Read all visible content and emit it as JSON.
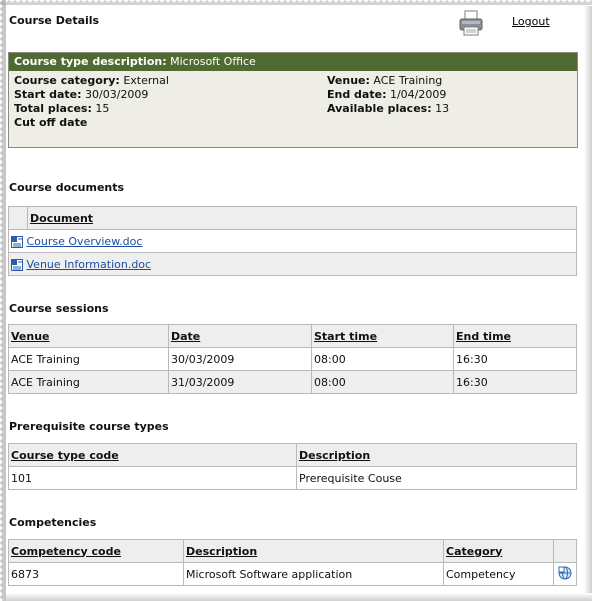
{
  "header": {
    "title": "Course Details",
    "logout_label": "Logout"
  },
  "summary": {
    "type_label": "Course type description:",
    "type_value": "Microsoft Office",
    "category_label": "Course category:",
    "category_value": "External",
    "start_label": "Start date:",
    "start_value": "30/03/2009",
    "total_label": "Total places:",
    "total_value": "15",
    "cutoff_label": "Cut off date",
    "venue_label": "Venue:",
    "venue_value": "ACE Training",
    "end_label": "End date:",
    "end_value": "1/04/2009",
    "available_label": "Available places:",
    "available_value": "13"
  },
  "documents": {
    "title": "Course documents",
    "header": "Document",
    "items": [
      "Course Overview.doc",
      "Venue Information.doc"
    ]
  },
  "sessions": {
    "title": "Course sessions",
    "headers": [
      "Venue",
      "Date",
      "Start time",
      "End time"
    ],
    "rows": [
      [
        "ACE Training",
        "30/03/2009",
        "08:00",
        "16:30"
      ],
      [
        "ACE Training",
        "31/03/2009",
        "08:00",
        "16:30"
      ]
    ]
  },
  "prerequisites": {
    "title": "Prerequisite course types",
    "headers": [
      "Course type code",
      "Description"
    ],
    "rows": [
      [
        "101",
        "Prerequisite Couse"
      ]
    ]
  },
  "competencies": {
    "title": "Competencies",
    "headers": [
      "Competency code",
      "Description",
      "Category"
    ],
    "rows": [
      [
        "6873",
        "Microsoft Software application",
        "Competency"
      ]
    ]
  },
  "icons": {
    "print": "printer-icon",
    "document": "word-document-icon",
    "info": "info-globe-icon"
  },
  "colors": {
    "summary_header": "#4f6b32",
    "summary_bg": "#efeee6",
    "link": "#1d4ea3"
  }
}
